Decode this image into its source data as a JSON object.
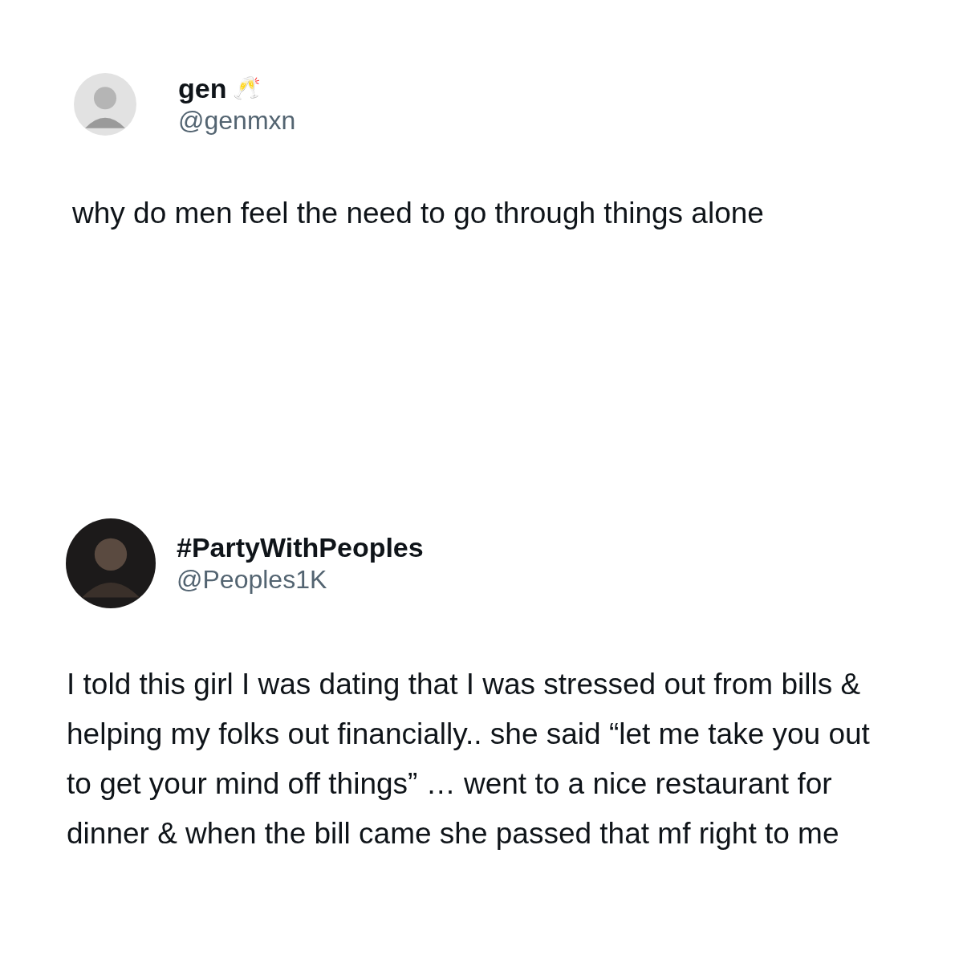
{
  "posts": [
    {
      "name": "gen",
      "name_emoji": "🥂",
      "handle": "@genmxn",
      "text": "why do men feel the need to go through things alone"
    },
    {
      "name": "#PartyWithPeoples",
      "handle": "@Peoples1K",
      "text": "I told this girl I was dating that I was stressed out from bills & helping my folks out financially.. she said “let me take you out to get your mind off things” … went to a nice restaurant for dinner & when the bill came she passed that mf right to me"
    }
  ]
}
